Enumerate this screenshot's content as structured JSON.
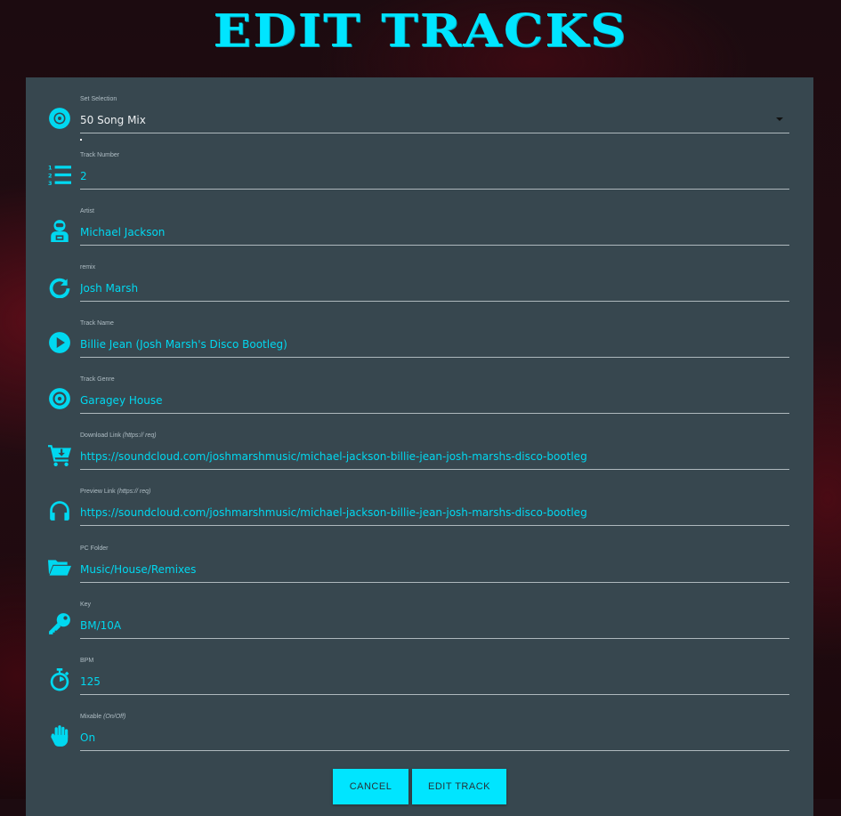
{
  "page": {
    "title": "EDIT TRACKS"
  },
  "fields": [
    {
      "name": "set-selection",
      "icon": "vinyl-disc-icon",
      "label": "Set Selection",
      "label_hint": "",
      "value": "50 Song Mix",
      "kind": "select"
    },
    {
      "name": "track-number",
      "icon": "numbered-list-icon",
      "label": "Track Number",
      "label_hint": "",
      "value": "2"
    },
    {
      "name": "artist",
      "icon": "astronaut-icon",
      "label": "Artist",
      "label_hint": "",
      "value": "Michael Jackson"
    },
    {
      "name": "remix",
      "icon": "redo-arrow-icon",
      "label": "remix",
      "label_hint": "",
      "value": "Josh Marsh"
    },
    {
      "name": "track-name",
      "icon": "play-circle-icon",
      "label": "Track Name",
      "label_hint": "",
      "value": "Billie Jean (Josh Marsh's Disco Bootleg)"
    },
    {
      "name": "track-genre",
      "icon": "record-disc-icon",
      "label": "Track Genre",
      "label_hint": "",
      "value": "Garagey House"
    },
    {
      "name": "download-link",
      "icon": "cart-download-icon",
      "label": "Download Link",
      "label_hint": "(https:// req)",
      "value": "https://soundcloud.com/joshmarshmusic/michael-jackson-billie-jean-josh-marshs-disco-bootleg"
    },
    {
      "name": "preview-link",
      "icon": "headphones-icon",
      "label": "Preview Link",
      "label_hint": "(https:// req)",
      "value": "https://soundcloud.com/joshmarshmusic/michael-jackson-billie-jean-josh-marshs-disco-bootleg"
    },
    {
      "name": "pc-folder",
      "icon": "folder-open-icon",
      "label": "PC Folder",
      "label_hint": "",
      "value": "Music/House/Remixes"
    },
    {
      "name": "key",
      "icon": "key-icon",
      "label": "Key",
      "label_hint": "",
      "value": "BM/10A"
    },
    {
      "name": "bpm",
      "icon": "stopwatch-icon",
      "label": "BPM",
      "label_hint": "",
      "value": "125"
    },
    {
      "name": "mixable",
      "icon": "hand-icon",
      "label": "Mixable",
      "label_hint": "(On/Off)",
      "value": "On"
    }
  ],
  "buttons": {
    "cancel": "CANCEL",
    "submit": "EDIT TRACK"
  },
  "colors": {
    "accent": "#00e5ff",
    "panel": "#37474f",
    "value_text": "#00d8f0"
  }
}
